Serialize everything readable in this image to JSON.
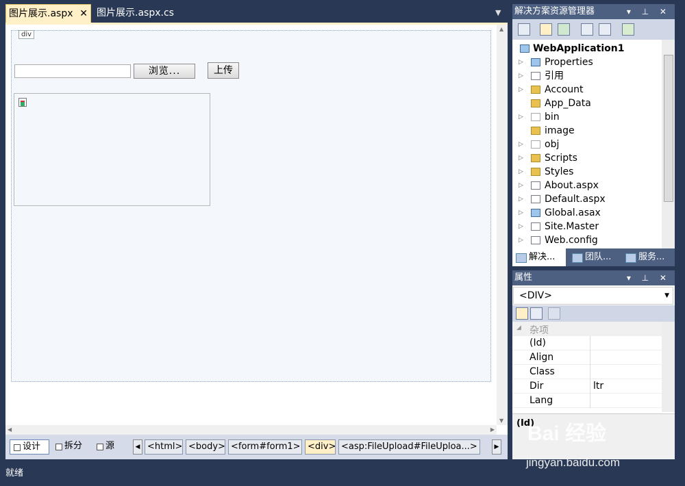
{
  "tabs": [
    {
      "label": "图片展示.aspx",
      "close": "✕"
    },
    {
      "label": "图片展示.aspx.cs"
    }
  ],
  "tab_dropdown": "▼",
  "designer": {
    "div_tag": "div",
    "browse_label": "浏览...",
    "upload_label": "上传"
  },
  "view_buttons": [
    {
      "label": "设计"
    },
    {
      "label": "拆分"
    },
    {
      "label": "源"
    }
  ],
  "breadcrumbs": [
    "<html>",
    "<body>",
    "<form#form1>",
    "<div>",
    "<asp:FileUpload#FileUploa...>"
  ],
  "status": "就绪",
  "solution_explorer": {
    "title": "解决方案资源管理器",
    "title_controls": "▾ ⊥ ✕",
    "project": "WebApplication1",
    "items": [
      {
        "label": "Properties"
      },
      {
        "label": "引用"
      },
      {
        "label": "Account"
      },
      {
        "label": "App_Data"
      },
      {
        "label": "bin"
      },
      {
        "label": "image"
      },
      {
        "label": "obj"
      },
      {
        "label": "Scripts"
      },
      {
        "label": "Styles"
      },
      {
        "label": "About.aspx"
      },
      {
        "label": "Default.aspx"
      },
      {
        "label": "Global.asax"
      },
      {
        "label": "Site.Master"
      },
      {
        "label": "Web.config"
      }
    ],
    "bottom_tabs": [
      "解决...",
      "团队...",
      "服务..."
    ]
  },
  "properties": {
    "title": "属性",
    "title_controls": "▾ ⊥ ✕",
    "selected_object": "<DIV>",
    "category": "杂项",
    "rows": [
      {
        "name": "(Id)",
        "value": ""
      },
      {
        "name": "Align",
        "value": ""
      },
      {
        "name": "Class",
        "value": ""
      },
      {
        "name": "Dir",
        "value": "ltr"
      },
      {
        "name": "Lang",
        "value": ""
      }
    ],
    "description_title": "(Id)"
  },
  "watermark": {
    "text": "Bai 经验",
    "url": "jingyan.baidu.com"
  },
  "colors": {
    "chrome": "#293955",
    "active_tab": "#fff0c8",
    "panel_title": "#4d6082"
  }
}
